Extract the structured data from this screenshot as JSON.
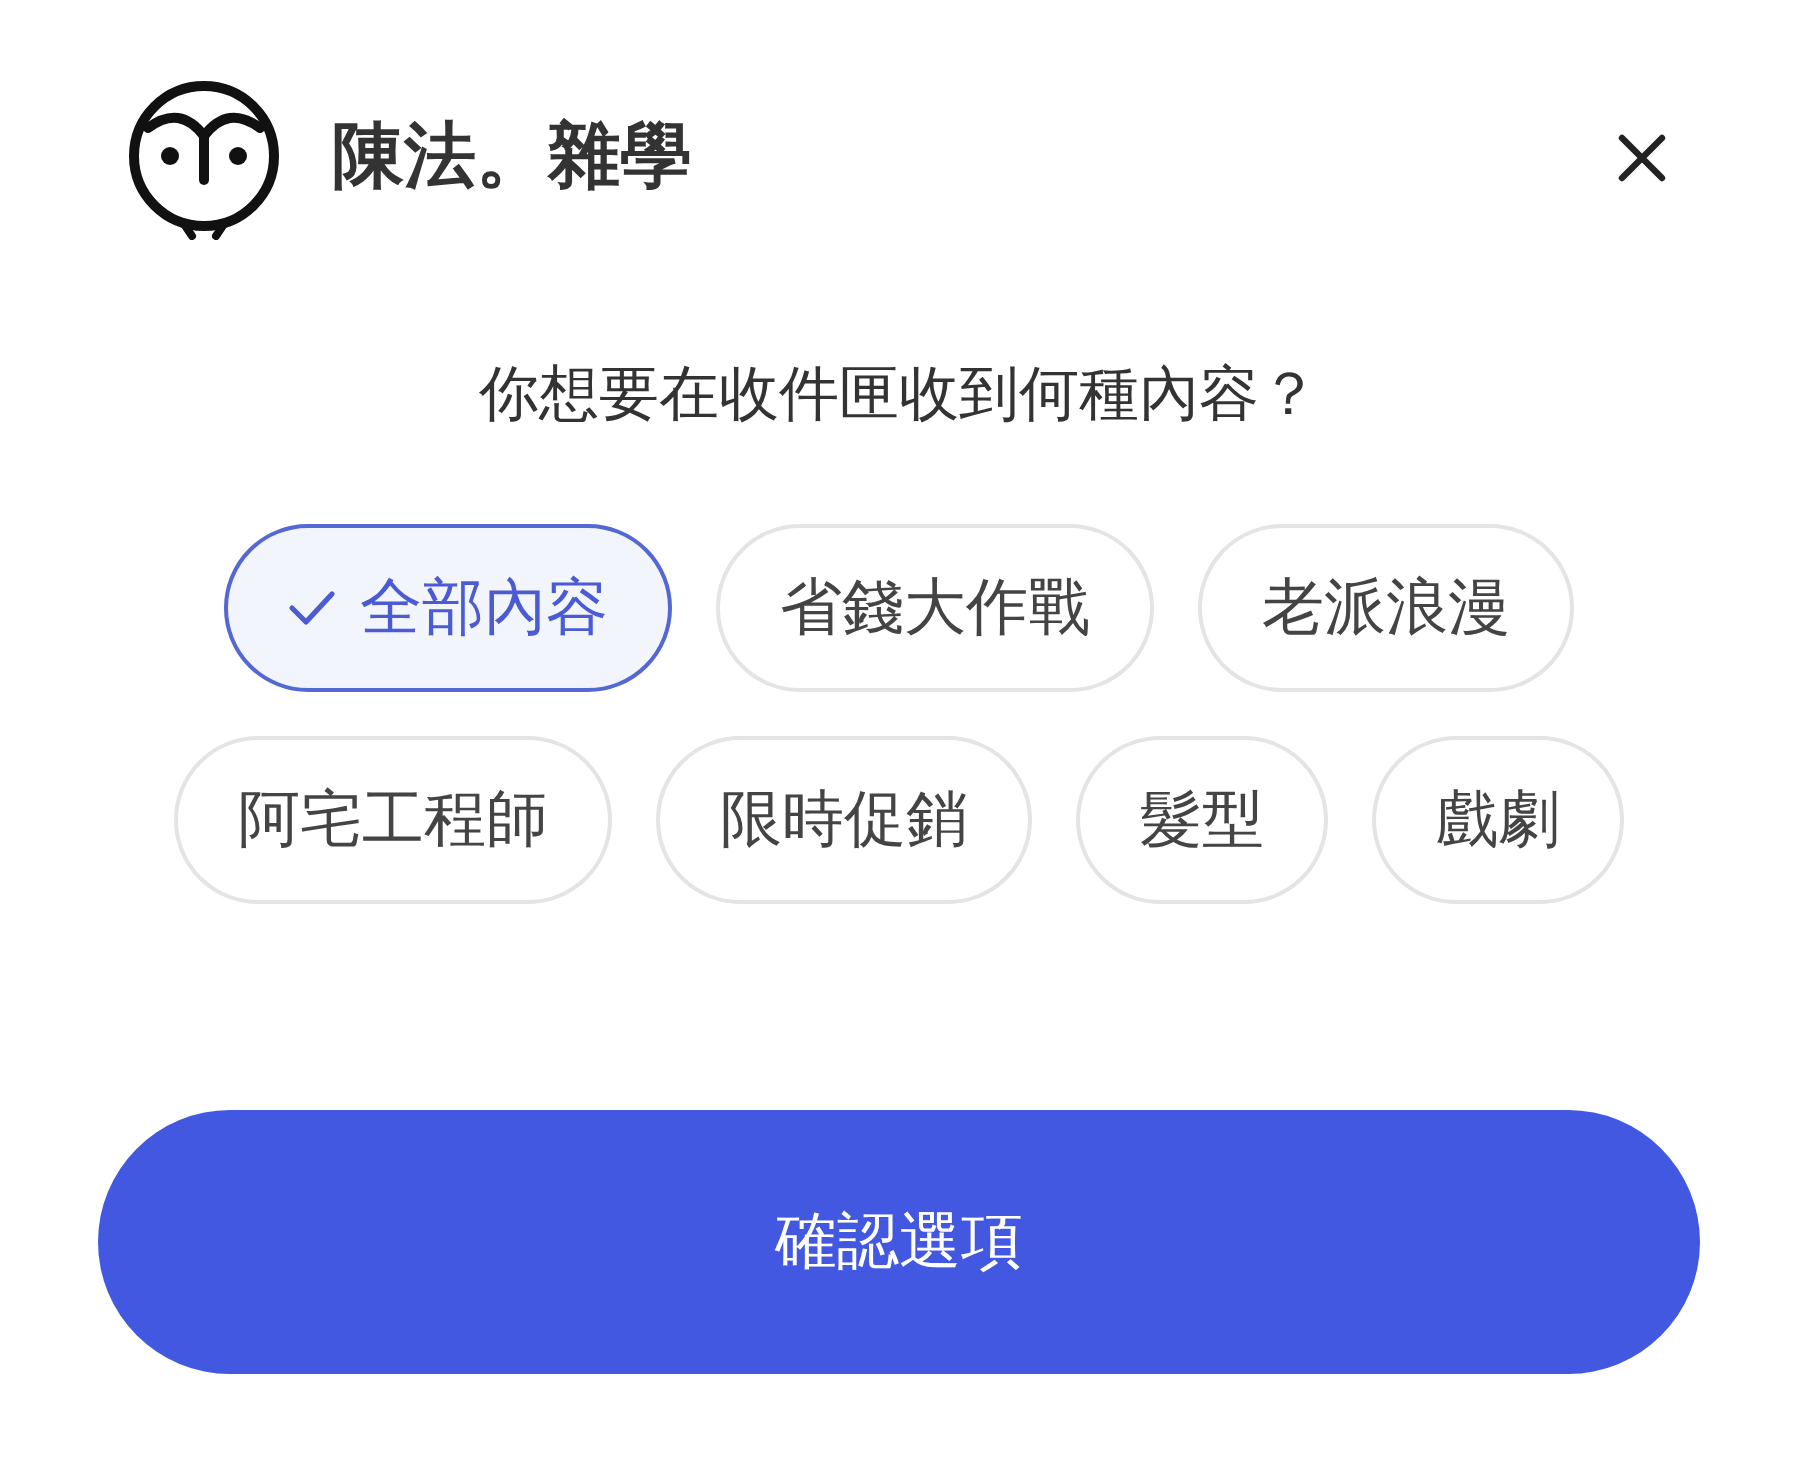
{
  "header": {
    "title": "陳法。雜學"
  },
  "question": "你想要在收件匣收到何種內容？",
  "option_rows": [
    {
      "options": [
        {
          "label": "全部內容",
          "selected": true
        },
        {
          "label": "省錢大作戰",
          "selected": false
        },
        {
          "label": "老派浪漫",
          "selected": false
        }
      ]
    },
    {
      "options": [
        {
          "label": "阿宅工程師",
          "selected": false
        },
        {
          "label": "限時促銷",
          "selected": false
        },
        {
          "label": "髮型",
          "selected": false
        },
        {
          "label": "戲劇",
          "selected": false
        }
      ]
    }
  ],
  "confirm_button": "確認選項"
}
